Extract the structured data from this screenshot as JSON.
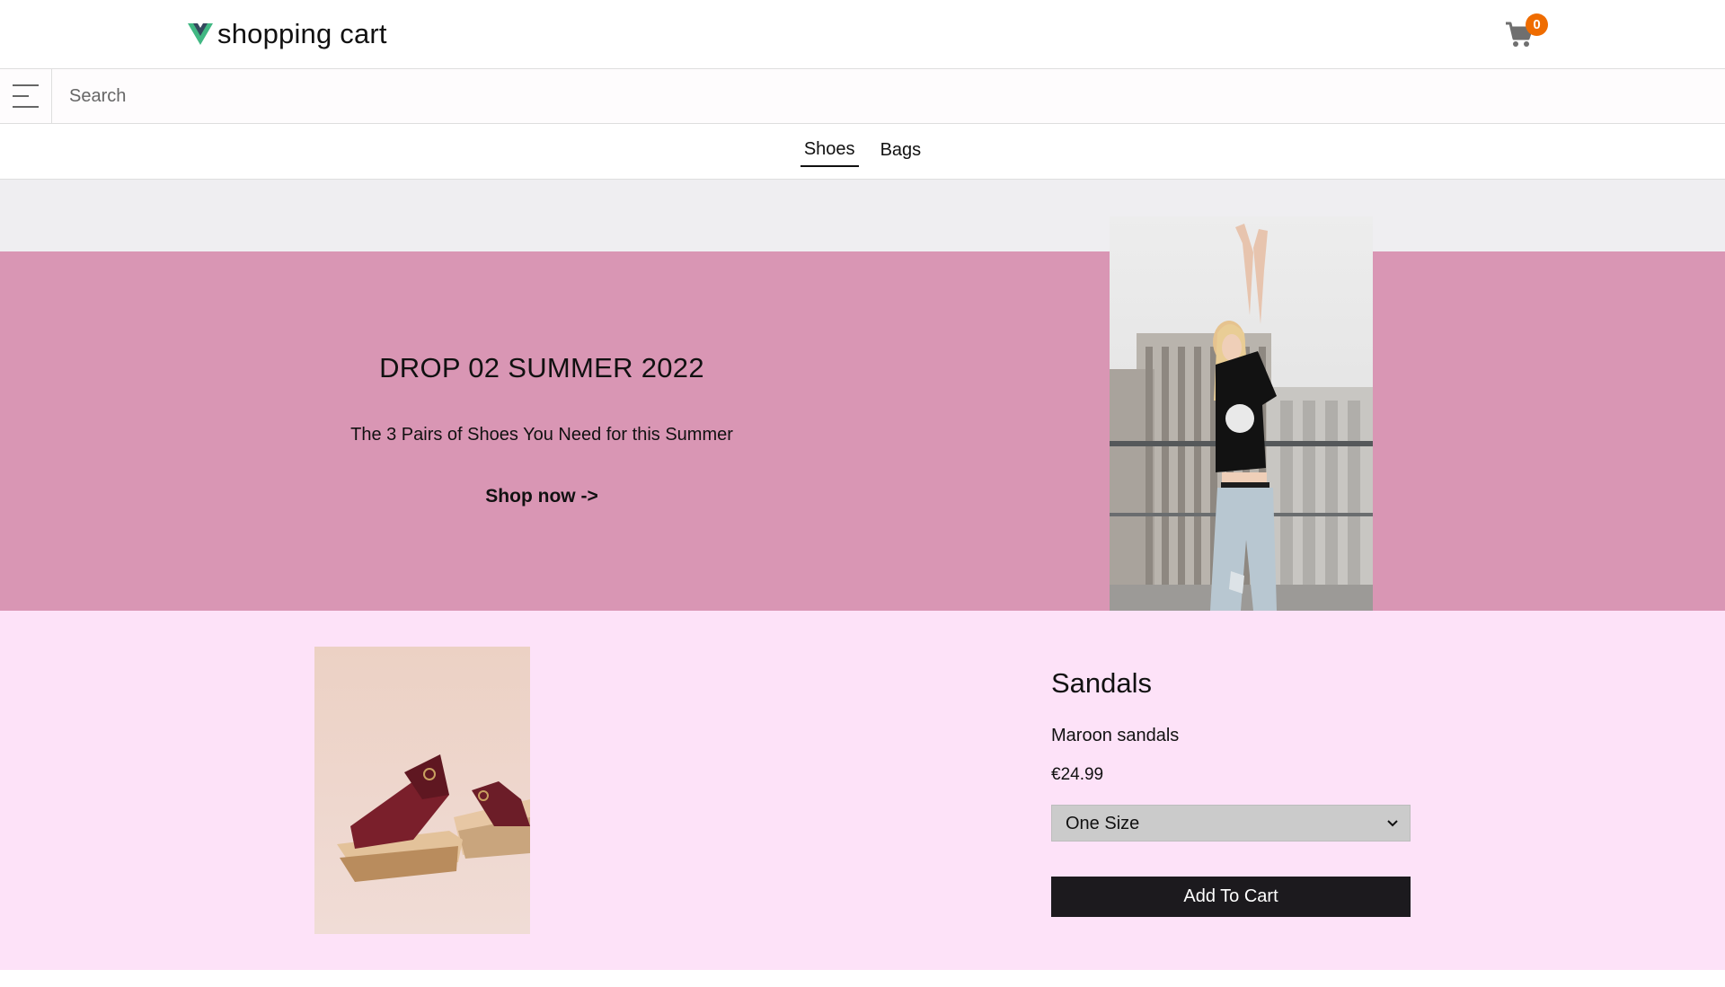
{
  "header": {
    "brand_text": "shopping cart",
    "logo_icon": "vue-logo-icon",
    "cart_icon": "shopping-cart-icon",
    "cart_count": "0",
    "badge_color": "#ef6c00"
  },
  "search": {
    "menu_icon": "hamburger-menu-icon",
    "placeholder": "Search"
  },
  "tabs": [
    {
      "label": "Shoes",
      "active": true
    },
    {
      "label": "Bags",
      "active": false
    }
  ],
  "hero": {
    "title": "DROP 02 SUMMER 2022",
    "subtitle": "The 3 Pairs of Shoes You Need for this Summer",
    "cta": "Shop now ->",
    "background_color": "#d996b4"
  },
  "product": {
    "name": "Sandals",
    "description": "Maroon sandals",
    "price": "€24.99",
    "size_selected": "One Size",
    "add_button": "Add To Cart",
    "background_color": "#fde2f8"
  }
}
